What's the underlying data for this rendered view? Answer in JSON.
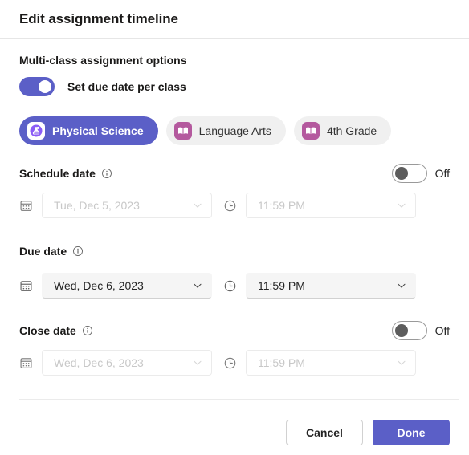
{
  "dialog": {
    "title": "Edit assignment timeline"
  },
  "multiclass": {
    "section_label": "Multi-class assignment options",
    "toggle": {
      "label": "Set due date per class",
      "state": "on"
    }
  },
  "classes": [
    {
      "name": "Physical Science",
      "icon": "flask-icon",
      "selected": true
    },
    {
      "name": "Language Arts",
      "icon": "book-icon",
      "selected": false
    },
    {
      "name": "4th Grade",
      "icon": "book-icon",
      "selected": false
    }
  ],
  "schedule_date": {
    "label": "Schedule date",
    "info_icon": "info-icon",
    "toggle_state_label": "Off",
    "enabled": false,
    "date": {
      "icon": "calendar-icon",
      "value": "Tue, Dec 5, 2023",
      "chevron": "chevron-down-icon"
    },
    "time": {
      "icon": "clock-icon",
      "value": "11:59 PM",
      "chevron": "chevron-down-icon"
    }
  },
  "due_date": {
    "label": "Due date",
    "info_icon": "info-icon",
    "enabled": true,
    "date": {
      "icon": "calendar-icon",
      "value": "Wed, Dec 6, 2023",
      "chevron": "chevron-down-icon"
    },
    "time": {
      "icon": "clock-icon",
      "value": "11:59 PM",
      "chevron": "chevron-down-icon"
    }
  },
  "close_date": {
    "label": "Close date",
    "info_icon": "info-icon",
    "toggle_state_label": "Off",
    "enabled": false,
    "date": {
      "icon": "calendar-icon",
      "value": "Wed, Dec 6, 2023",
      "chevron": "chevron-down-icon"
    },
    "time": {
      "icon": "clock-icon",
      "value": "11:59 PM",
      "chevron": "chevron-down-icon"
    }
  },
  "footer": {
    "cancel_label": "Cancel",
    "done_label": "Done"
  },
  "colors": {
    "accent": "#5b5fc7",
    "class_avatar_book": "#b4599e",
    "field_fill": "#f5f5f5",
    "divider": "#ebebeb"
  }
}
